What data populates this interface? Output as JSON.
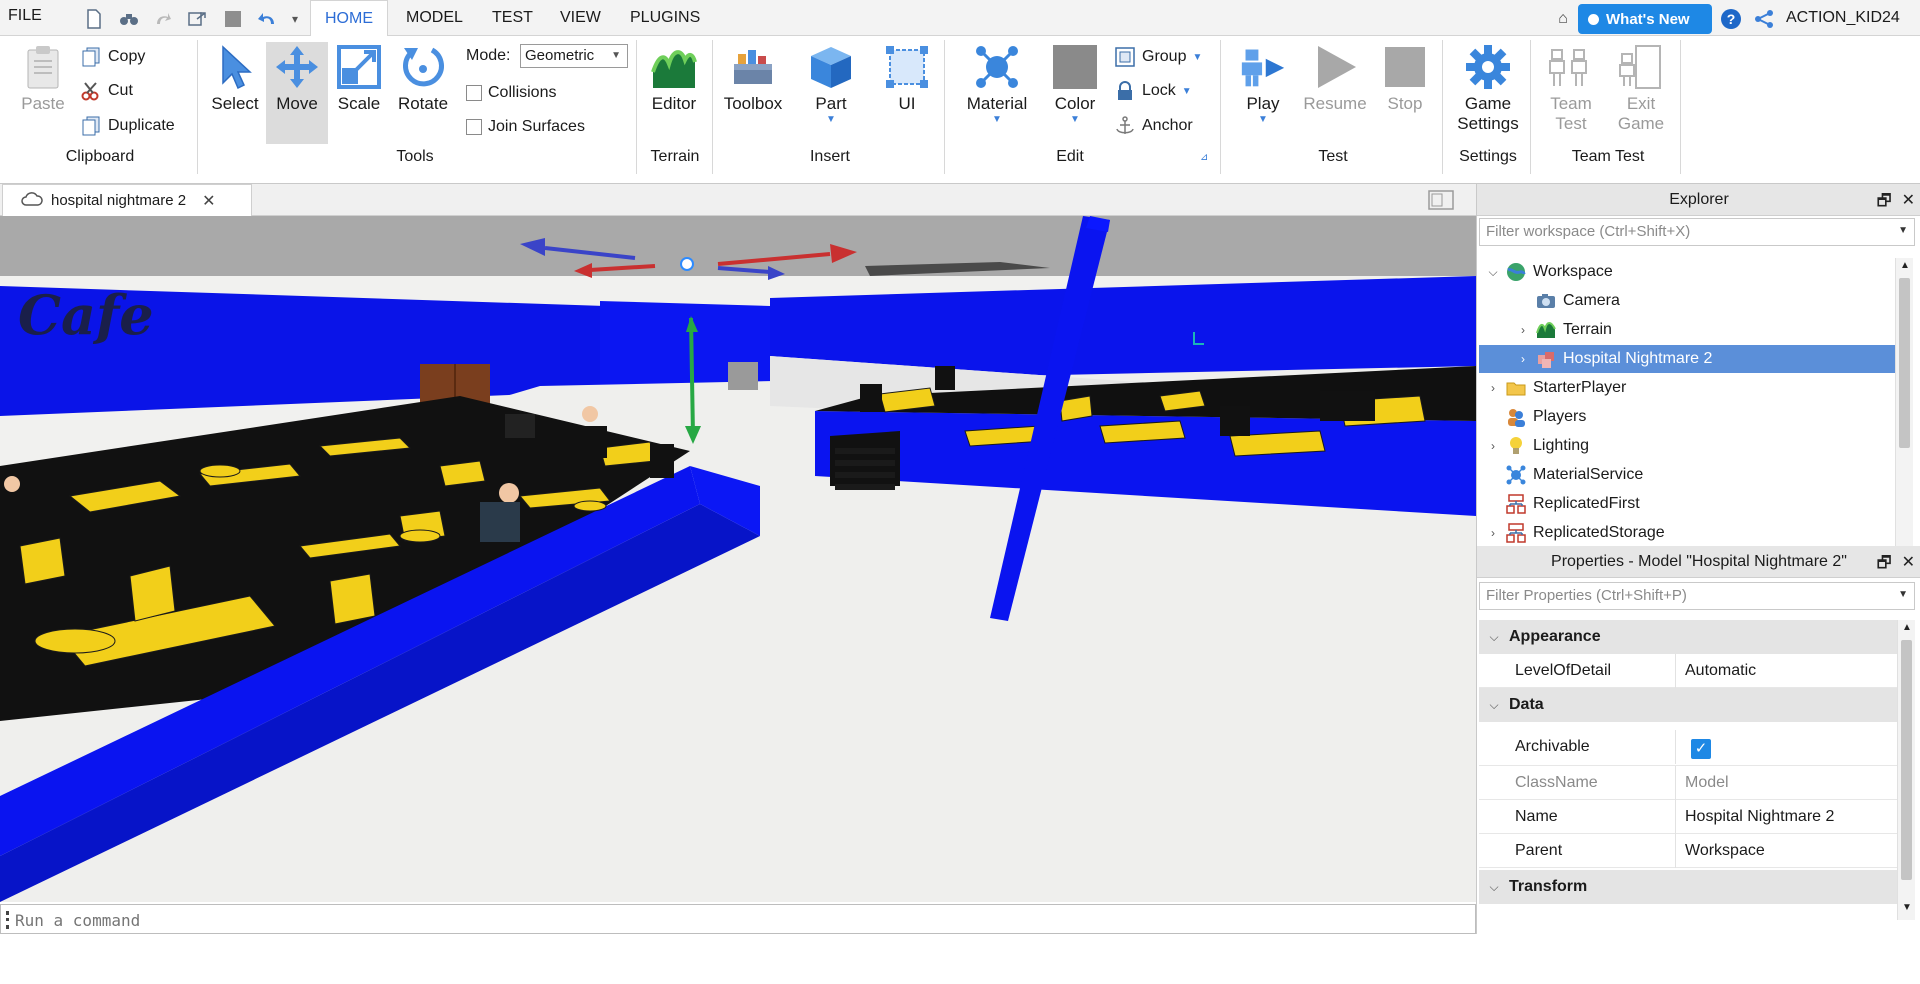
{
  "menubar": {
    "file_label": "FILE",
    "tabs": [
      {
        "label": "HOME",
        "active": true
      },
      {
        "label": "MODEL"
      },
      {
        "label": "TEST"
      },
      {
        "label": "VIEW"
      },
      {
        "label": "PLUGINS"
      }
    ],
    "whats_new": "What's New",
    "username": "ACTION_KID24"
  },
  "ribbon": {
    "clipboard": {
      "paste": "Paste",
      "copy": "Copy",
      "cut": "Cut",
      "duplicate": "Duplicate",
      "label": "Clipboard"
    },
    "tools": {
      "select": "Select",
      "move": "Move",
      "scale": "Scale",
      "rotate": "Rotate",
      "mode_label": "Mode:",
      "mode_value": "Geometric",
      "collisions": "Collisions",
      "join_surfaces": "Join Surfaces",
      "label": "Tools"
    },
    "terrain": {
      "editor": "Editor",
      "label": "Terrain"
    },
    "insert": {
      "toolbox": "Toolbox",
      "part": "Part",
      "ui": "UI",
      "label": "Insert"
    },
    "edit": {
      "material": "Material",
      "color": "Color",
      "group": "Group",
      "lock": "Lock",
      "anchor": "Anchor",
      "label": "Edit"
    },
    "test": {
      "play": "Play",
      "resume": "Resume",
      "stop": "Stop",
      "label": "Test"
    },
    "settings": {
      "game_settings_1": "Game",
      "game_settings_2": "Settings",
      "label": "Settings"
    },
    "team_test": {
      "team_test_1": "Team",
      "team_test_2": "Test",
      "exit_game_1": "Exit",
      "exit_game_2": "Game",
      "label": "Team Test"
    }
  },
  "document": {
    "tab_title": "hospital nightmare 2"
  },
  "viewport": {
    "sign_text": "Cafe"
  },
  "command_bar": {
    "placeholder": "Run a command"
  },
  "explorer": {
    "title": "Explorer",
    "filter_placeholder": "Filter workspace (Ctrl+Shift+X)",
    "items": [
      {
        "label": "Workspace",
        "expander": "down",
        "indent": 0,
        "icon": "workspace-icon"
      },
      {
        "label": "Camera",
        "expander": "",
        "indent": 1,
        "icon": "camera-icon"
      },
      {
        "label": "Terrain",
        "expander": "right",
        "indent": 1,
        "icon": "terrain-icon"
      },
      {
        "label": "Hospital Nightmare 2",
        "expander": "right",
        "indent": 1,
        "icon": "model-icon",
        "selected": true
      },
      {
        "label": "StarterPlayer",
        "expander": "right",
        "indent": 0,
        "icon": "folder-icon"
      },
      {
        "label": "Players",
        "expander": "",
        "indent": 0,
        "icon": "players-icon"
      },
      {
        "label": "Lighting",
        "expander": "right",
        "indent": 0,
        "icon": "lightbulb-icon"
      },
      {
        "label": "MaterialService",
        "expander": "",
        "indent": 0,
        "icon": "material-service-icon"
      },
      {
        "label": "ReplicatedFirst",
        "expander": "",
        "indent": 0,
        "icon": "replicated-icon"
      },
      {
        "label": "ReplicatedStorage",
        "expander": "right",
        "indent": 0,
        "icon": "replicated-icon"
      }
    ]
  },
  "properties": {
    "title": "Properties - Model \"Hospital Nightmare 2\"",
    "filter_placeholder": "Filter Properties (Ctrl+Shift+P)",
    "categories": {
      "appearance": "Appearance",
      "data": "Data",
      "transform": "Transform"
    },
    "rows": {
      "level_of_detail": {
        "name": "LevelOfDetail",
        "value": "Automatic"
      },
      "archivable": {
        "name": "Archivable",
        "value": true
      },
      "class_name": {
        "name": "ClassName",
        "value": "Model"
      },
      "name": {
        "name": "Name",
        "value": "Hospital Nightmare 2"
      },
      "parent": {
        "name": "Parent",
        "value": "Workspace"
      }
    }
  },
  "colors": {
    "accent": "#1e88e5",
    "selection": "#5b8fd9",
    "wall_blue": "#0a14f0",
    "furniture_yellow": "#f2cf1a"
  }
}
